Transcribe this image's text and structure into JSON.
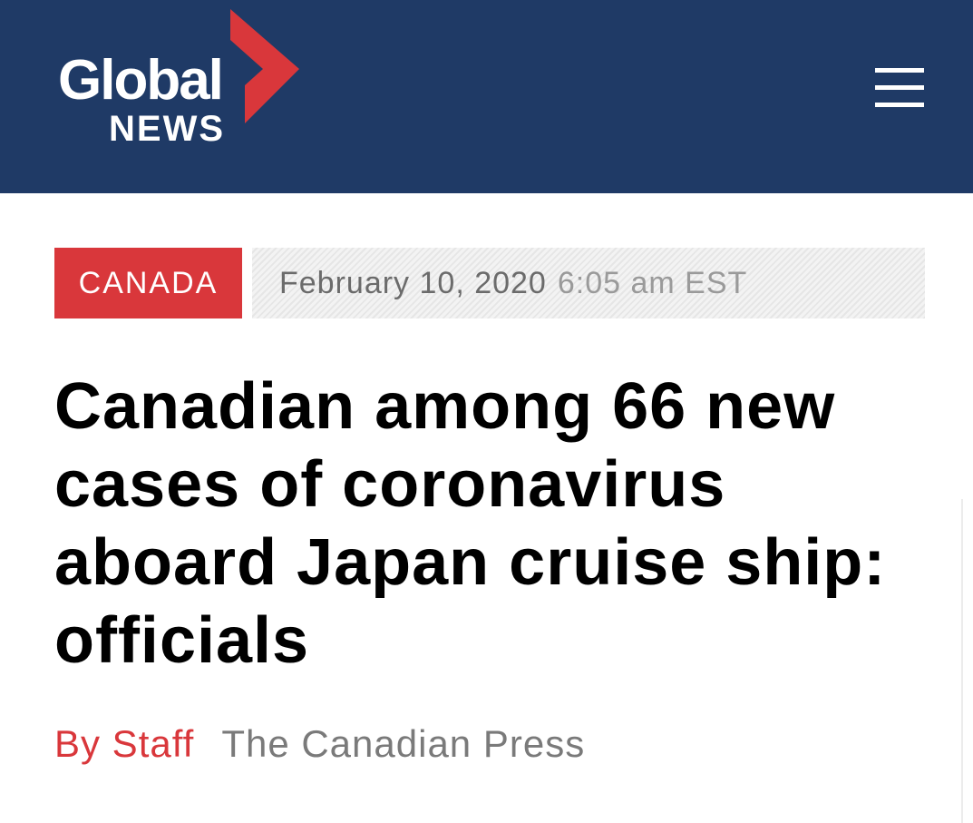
{
  "header": {
    "logo": {
      "word_top": "Global",
      "word_bottom": "NEWS",
      "icon": "global-news-chevron"
    },
    "menu_icon": "hamburger-menu-icon",
    "colors": {
      "background": "#1f3a66",
      "accent": "#d9373b"
    }
  },
  "article": {
    "category": "CANADA",
    "date": "February 10, 2020",
    "time": "6:05 am EST",
    "headline": "Canadian among 66 new cases of coronavirus aboard Japan cruise ship: officials",
    "byline": {
      "author": "By Staff",
      "source": "The Canadian Press"
    }
  }
}
